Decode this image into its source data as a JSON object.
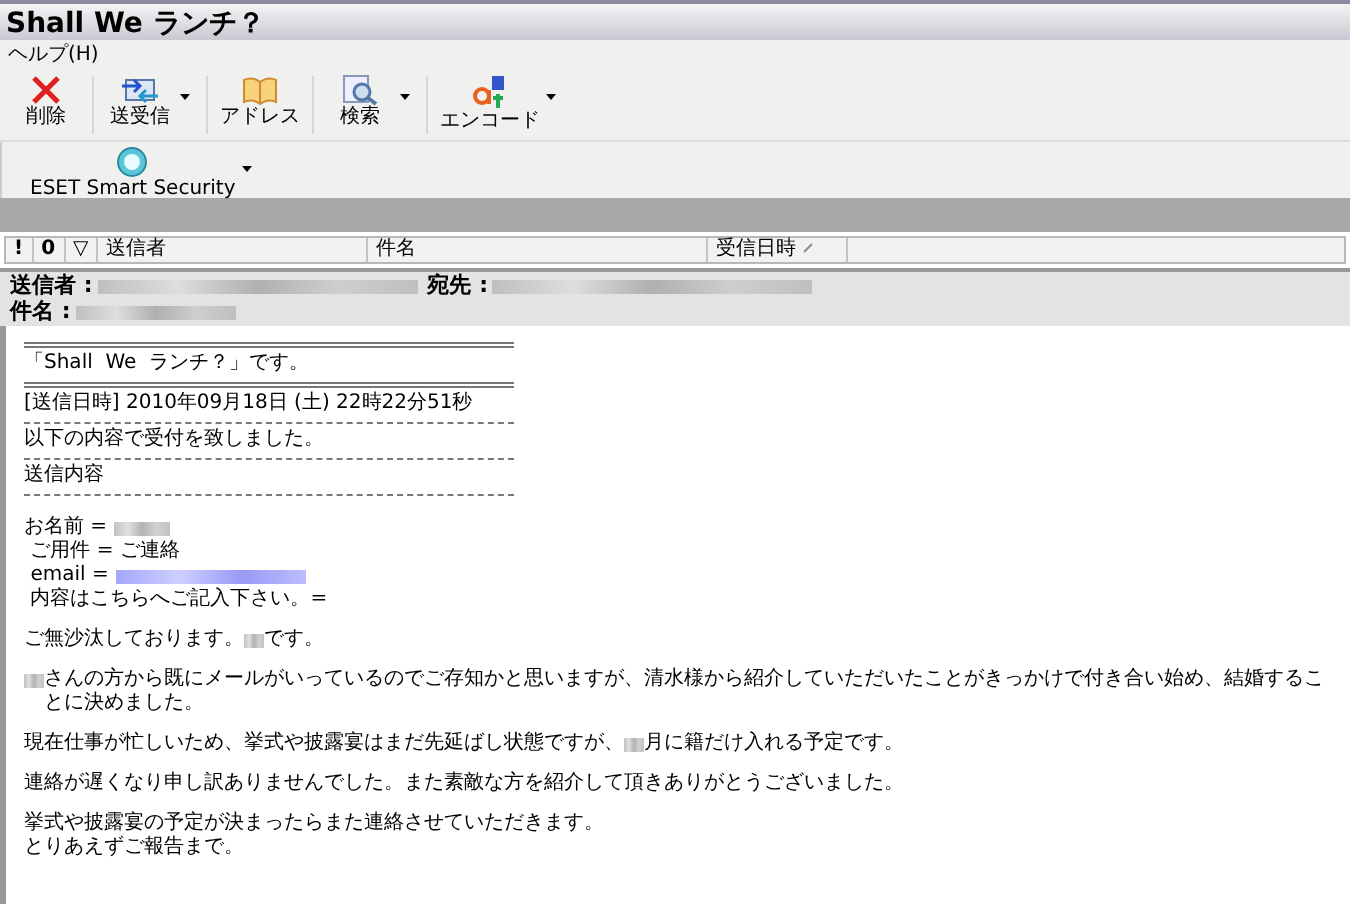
{
  "window": {
    "title": "Shall We ランチ？"
  },
  "menu": [
    {
      "label": "ヘルプ(H)"
    }
  ],
  "toolbar": [
    {
      "label": "削除",
      "dropdown": false
    },
    {
      "label": "送受信",
      "dropdown": true
    },
    {
      "label": "アドレス",
      "dropdown": false
    },
    {
      "label": "検索",
      "dropdown": true
    },
    {
      "label": "エンコード",
      "dropdown": true
    }
  ],
  "toolbar_2": [
    {
      "label": "ESET Smart Security",
      "dropdown": true
    }
  ],
  "columns": [
    {
      "label": "!",
      "kind": "icon"
    },
    {
      "label": "0",
      "kind": "icon"
    },
    {
      "label": "▽",
      "kind": "icon"
    },
    {
      "label": "送信者",
      "kind": "text"
    },
    {
      "label": "件名",
      "kind": "text"
    },
    {
      "label": "受信日時",
      "kind": "sorted"
    }
  ],
  "header": [
    {
      "label": "送信者 :",
      "kind": "redacted-long"
    },
    {
      "label": "宛先 :",
      "kind": "redacted-long"
    },
    {
      "label": "件名 :",
      "kind": "redacted"
    }
  ],
  "body": [
    {
      "kind": "double-rule"
    },
    {
      "kind": "text",
      "segments": [
        {
          "kind": "text",
          "text": "「Shall  We  ランチ？」です。"
        }
      ]
    },
    {
      "kind": "double-rule"
    },
    {
      "kind": "text",
      "segments": [
        {
          "kind": "text",
          "text": "[送信日時] 2010年09月18日 (土) 22時22分51秒"
        }
      ]
    },
    {
      "kind": "rule"
    },
    {
      "kind": "text",
      "segments": [
        {
          "kind": "text",
          "text": "以下の内容で受付を致しました。"
        }
      ]
    },
    {
      "kind": "rule"
    },
    {
      "kind": "text",
      "segments": [
        {
          "kind": "text",
          "text": "送信内容"
        }
      ]
    },
    {
      "kind": "rule"
    },
    {
      "kind": "blank"
    },
    {
      "kind": "text",
      "segments": [
        {
          "kind": "text",
          "text": "お名前 = "
        },
        {
          "kind": "redacted"
        }
      ]
    },
    {
      "kind": "text",
      "segments": [
        {
          "kind": "text",
          "text": " ご用件 = ご連絡"
        }
      ]
    },
    {
      "kind": "text",
      "segments": [
        {
          "kind": "text",
          "text": " email = "
        },
        {
          "kind": "redacted-link"
        }
      ]
    },
    {
      "kind": "text",
      "segments": [
        {
          "kind": "text",
          "text": " 内容はこちらへご記入下さい。="
        }
      ]
    },
    {
      "kind": "blank"
    },
    {
      "kind": "text",
      "segments": [
        {
          "kind": "text",
          "text": "ご無沙汰しております。"
        },
        {
          "kind": "redacted-short"
        },
        {
          "kind": "text",
          "text": "です。"
        }
      ]
    },
    {
      "kind": "blank"
    },
    {
      "kind": "text",
      "segments": [
        {
          "kind": "redacted-short"
        },
        {
          "kind": "text",
          "text": "さんの方から既にメールがいっているのでご存知かと思いますが、清水様から紹介していただいたことがきっかけで付き合い始め、結婚することに決めました。"
        }
      ]
    },
    {
      "kind": "blank"
    },
    {
      "kind": "text",
      "segments": [
        {
          "kind": "text",
          "text": "現在仕事が忙しいため、挙式や披露宴はまだ先延ばし状態ですが、"
        },
        {
          "kind": "redacted-short"
        },
        {
          "kind": "text",
          "text": "月に籍だけ入れる予定です。"
        }
      ]
    },
    {
      "kind": "blank"
    },
    {
      "kind": "text",
      "segments": [
        {
          "kind": "text",
          "text": "連絡が遅くなり申し訳ありませんでした。また素敵な方を紹介して頂きありがとうございました。"
        }
      ]
    },
    {
      "kind": "blank"
    },
    {
      "kind": "text",
      "segments": [
        {
          "kind": "text",
          "text": "挙式や披露宴の予定が決まったらまた連絡させていただきます。"
        }
      ]
    },
    {
      "kind": "text",
      "segments": [
        {
          "kind": "text",
          "text": "とりあえずご報告まで。"
        }
      ]
    }
  ]
}
